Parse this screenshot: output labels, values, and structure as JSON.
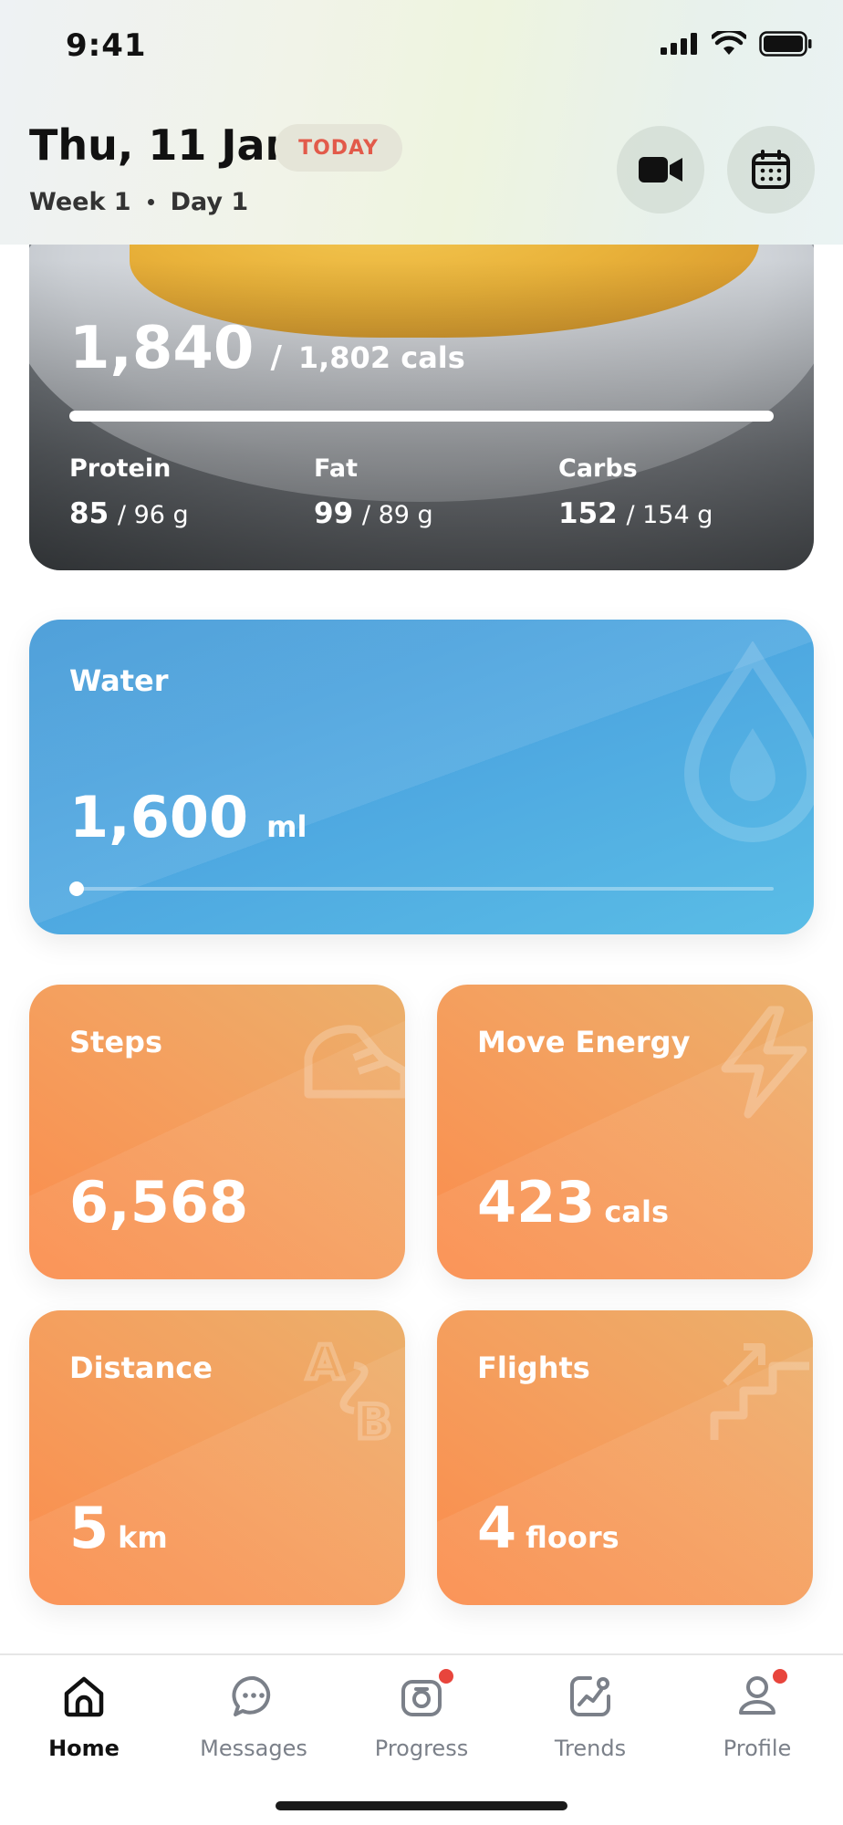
{
  "status_bar": {
    "time": "9:41"
  },
  "header": {
    "date": "Thu, 11 Jan",
    "badge": "TODAY",
    "week": "Week 1",
    "day": "Day 1",
    "icons": [
      "video-icon",
      "calendar-icon"
    ]
  },
  "nutrition": {
    "calories": "1,840",
    "separator": "/",
    "calories_target": "1,802 cals",
    "progress": 1.0,
    "macros": [
      {
        "label": "Protein",
        "value": "85",
        "target": "/ 96 g"
      },
      {
        "label": "Fat",
        "value": "99",
        "target": "/ 89 g"
      },
      {
        "label": "Carbs",
        "value": "152",
        "target": "/ 154 g"
      }
    ]
  },
  "water": {
    "label": "Water",
    "value": "1,600",
    "unit": "ml",
    "progress": 0.0
  },
  "tiles": [
    {
      "label": "Steps",
      "value": "6,568",
      "unit": "",
      "icon": "shoe-icon"
    },
    {
      "label": "Move Energy",
      "value": "423",
      "unit": "cals",
      "icon": "lightning-icon"
    },
    {
      "label": "Distance",
      "value": "5",
      "unit": "km",
      "icon": "a-to-b-icon"
    },
    {
      "label": "Flights",
      "value": "4",
      "unit": "floors",
      "icon": "stairs-icon"
    }
  ],
  "tabbar": {
    "items": [
      {
        "label": "Home",
        "icon": "home-icon",
        "active": true,
        "badge": false
      },
      {
        "label": "Messages",
        "icon": "chat-icon",
        "active": false,
        "badge": false
      },
      {
        "label": "Progress",
        "icon": "camera-icon",
        "active": false,
        "badge": true
      },
      {
        "label": "Trends",
        "icon": "trends-icon",
        "active": false,
        "badge": false
      },
      {
        "label": "Profile",
        "icon": "profile-icon",
        "active": false,
        "badge": true
      }
    ]
  },
  "colors": {
    "badge_text": "#e25a4a",
    "water": "#4da6e0",
    "tile": "#f4a05f",
    "notification": "#e8453c"
  }
}
